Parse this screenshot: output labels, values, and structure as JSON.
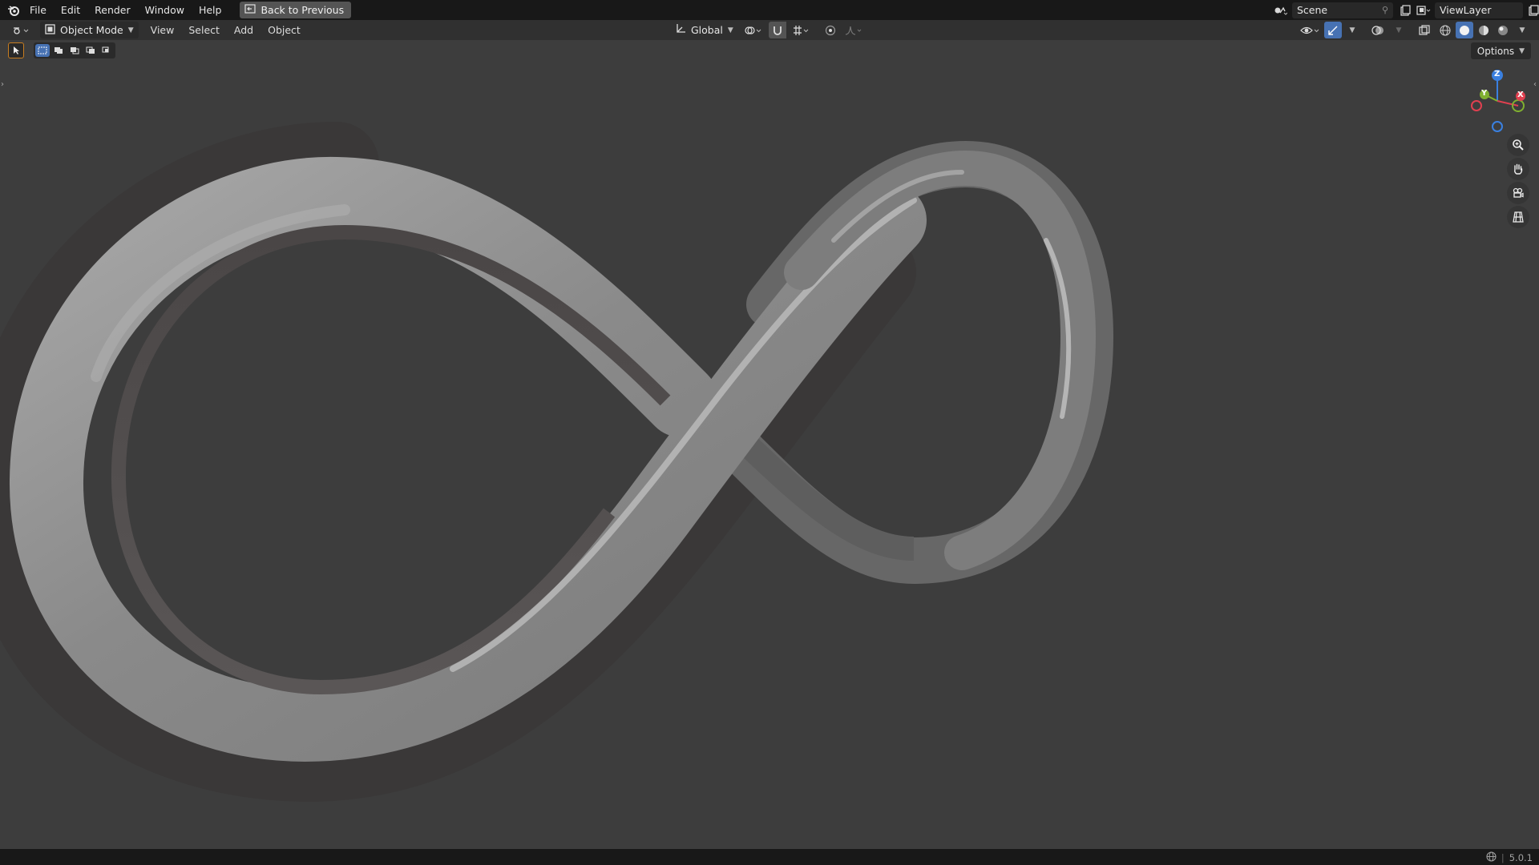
{
  "topbar": {
    "menus": [
      "File",
      "Edit",
      "Render",
      "Window",
      "Help"
    ],
    "back_button": "Back to Previous",
    "scene": "Scene",
    "view_layer": "ViewLayer"
  },
  "header": {
    "mode": "Object Mode",
    "menus": [
      "View",
      "Select",
      "Add",
      "Object"
    ],
    "orientation": "Global"
  },
  "viewport": {
    "options": "Options",
    "gizmo": {
      "z": "Z",
      "y": "Y",
      "x": "X"
    }
  },
  "status": {
    "version": "5.0.1"
  },
  "colors": {
    "axis_x": "#e04050",
    "axis_y": "#80b030",
    "axis_z": "#3a80e0",
    "viewport_bg": "#3d3d3d",
    "topbar_bg": "#181818",
    "accent": "#4772b3"
  },
  "icons": [
    "blender-logo-icon",
    "back-icon",
    "editor-type-icon",
    "object-mode-icon",
    "orientation-icon",
    "pivot-icon",
    "snap-icon",
    "snap-target-icon",
    "proportional-icon",
    "falloff-icon",
    "visibility-icon",
    "gizmo-icon",
    "overlay-icon",
    "xray-icon",
    "wireframe-shading-icon",
    "solid-shading-icon",
    "material-shading-icon",
    "rendered-shading-icon",
    "zoom-icon",
    "pan-hand-icon",
    "camera-icon",
    "ortho-grid-icon",
    "globe-icon",
    "scene-icon",
    "viewlayer-icon",
    "select-box-icon"
  ]
}
